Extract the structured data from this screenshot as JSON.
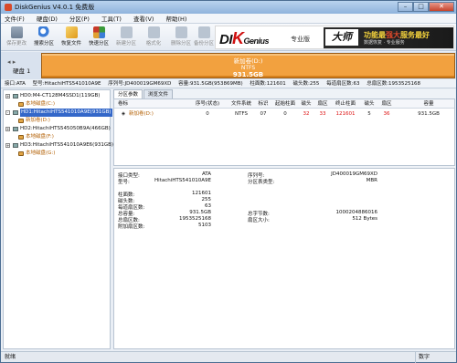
{
  "window": {
    "title": "DiskGenius V4.0.1 免费版",
    "min_label": "–",
    "max_label": "□",
    "close_label": "✕"
  },
  "menu": [
    "文件(F)",
    "硬盘(D)",
    "分区(P)",
    "工具(T)",
    "查看(V)",
    "帮助(H)"
  ],
  "toolbar": {
    "buttons": [
      {
        "label": "保存更改",
        "icon": "save-icon",
        "enabled": false
      },
      {
        "label": "搜索分区",
        "icon": "search-partition-icon",
        "enabled": true
      },
      {
        "label": "恢复文件",
        "icon": "recover-file-icon",
        "enabled": true
      },
      {
        "label": "快速分区",
        "icon": "quick-partition-icon",
        "enabled": true
      },
      {
        "label": "新建分区",
        "icon": "new-partition-icon",
        "enabled": false
      },
      {
        "label": "格式化",
        "icon": "format-icon",
        "enabled": false
      },
      {
        "label": "删除分区",
        "icon": "delete-partition-icon",
        "enabled": false
      },
      {
        "label": "备份分区",
        "icon": "backup-partition-icon",
        "enabled": false
      }
    ],
    "brand": {
      "logo_prefix": "D",
      "logo_k": "K",
      "logo_suffix": "Genius",
      "subtitle": "专业版",
      "ad_logo": "大师",
      "ad_line1_a": "功能最",
      "ad_line1_b": "强大",
      "ad_line1_c": "服务最好",
      "ad_line2": "数据恢复 · 专业服务"
    }
  },
  "disk_bar": {
    "nav": "◂ ▸",
    "label": "硬盘 1",
    "partition_name": "新加卷(D:)",
    "filesystem": "NTFS",
    "size": "931.5GB"
  },
  "info_line": {
    "interface": "接口:ATA",
    "model": "型号:HitachiHTS541010A9E",
    "serial": "序列号:JD400019GM69XD",
    "capacity": "容量:931.5GB(953869MB)",
    "cylinders": "柱面数:121601",
    "heads": "磁头数:255",
    "sectors": "每道扇区数:63",
    "total_sectors": "总扇区数:1953525168"
  },
  "tree": [
    {
      "type": "disk",
      "label": "HD0:M4-CT128M4SSD1(119GB)",
      "expander": "+",
      "selected": false,
      "level": 0
    },
    {
      "type": "partition",
      "label": "本地磁盘(C:)",
      "selected": false,
      "level": 1
    },
    {
      "type": "disk",
      "label": "HD1:HitachiHTS541010A9E(931GB)",
      "expander": "-",
      "selected": true,
      "level": 0
    },
    {
      "type": "partition",
      "label": "新加卷(D:)",
      "selected": false,
      "level": 1
    },
    {
      "type": "disk",
      "label": "HD2:HitachiHTS545050B9A(466GB)",
      "expander": "+",
      "selected": false,
      "level": 0
    },
    {
      "type": "partition",
      "label": "本地磁盘(F:)",
      "selected": false,
      "level": 1
    },
    {
      "type": "disk",
      "label": "HD3:HitachiHTS541010A9E6(931GB)",
      "expander": "+",
      "selected": false,
      "level": 0
    },
    {
      "type": "partition",
      "label": "本地磁盘(G:)",
      "selected": false,
      "level": 1
    }
  ],
  "tabs": [
    "分区参数",
    "浏览文件"
  ],
  "partition_table": {
    "headers": [
      "卷标",
      "序号(状态)",
      "文件系统",
      "标识",
      "起始柱面",
      "磁头",
      "扇区",
      "终止柱面",
      "磁头",
      "扇区",
      "容量"
    ],
    "rows": [
      {
        "cells": [
          "新加卷(D:)",
          "0",
          "NTFS",
          "07",
          "0",
          "32",
          "33",
          "121601",
          "5",
          "36",
          "931.5GB"
        ]
      }
    ]
  },
  "details": {
    "left": [
      {
        "label": "接口类型:",
        "value": "ATA"
      },
      {
        "label": "型号:",
        "value": "HitachiHTS541010A9E"
      },
      {
        "label": "柱面数:",
        "value": "121601"
      },
      {
        "label": "磁头数:",
        "value": "255"
      },
      {
        "label": "每道扇区数:",
        "value": "63"
      },
      {
        "label": "总容量:",
        "value": "931.5GB"
      },
      {
        "label": "总扇区数:",
        "value": "1953525168"
      },
      {
        "label": "附加扇区数:",
        "value": "5103"
      }
    ],
    "right": [
      {
        "label": "序列号:",
        "value": "JD400019GM69XD"
      },
      {
        "label": "分区表类型:",
        "value": "MBR"
      },
      {
        "label": "总字节数:",
        "value": "1000204886016"
      },
      {
        "label": "扇区大小:",
        "value": "512 Bytes"
      }
    ]
  },
  "status": {
    "left": "就绪",
    "right": "数字"
  }
}
